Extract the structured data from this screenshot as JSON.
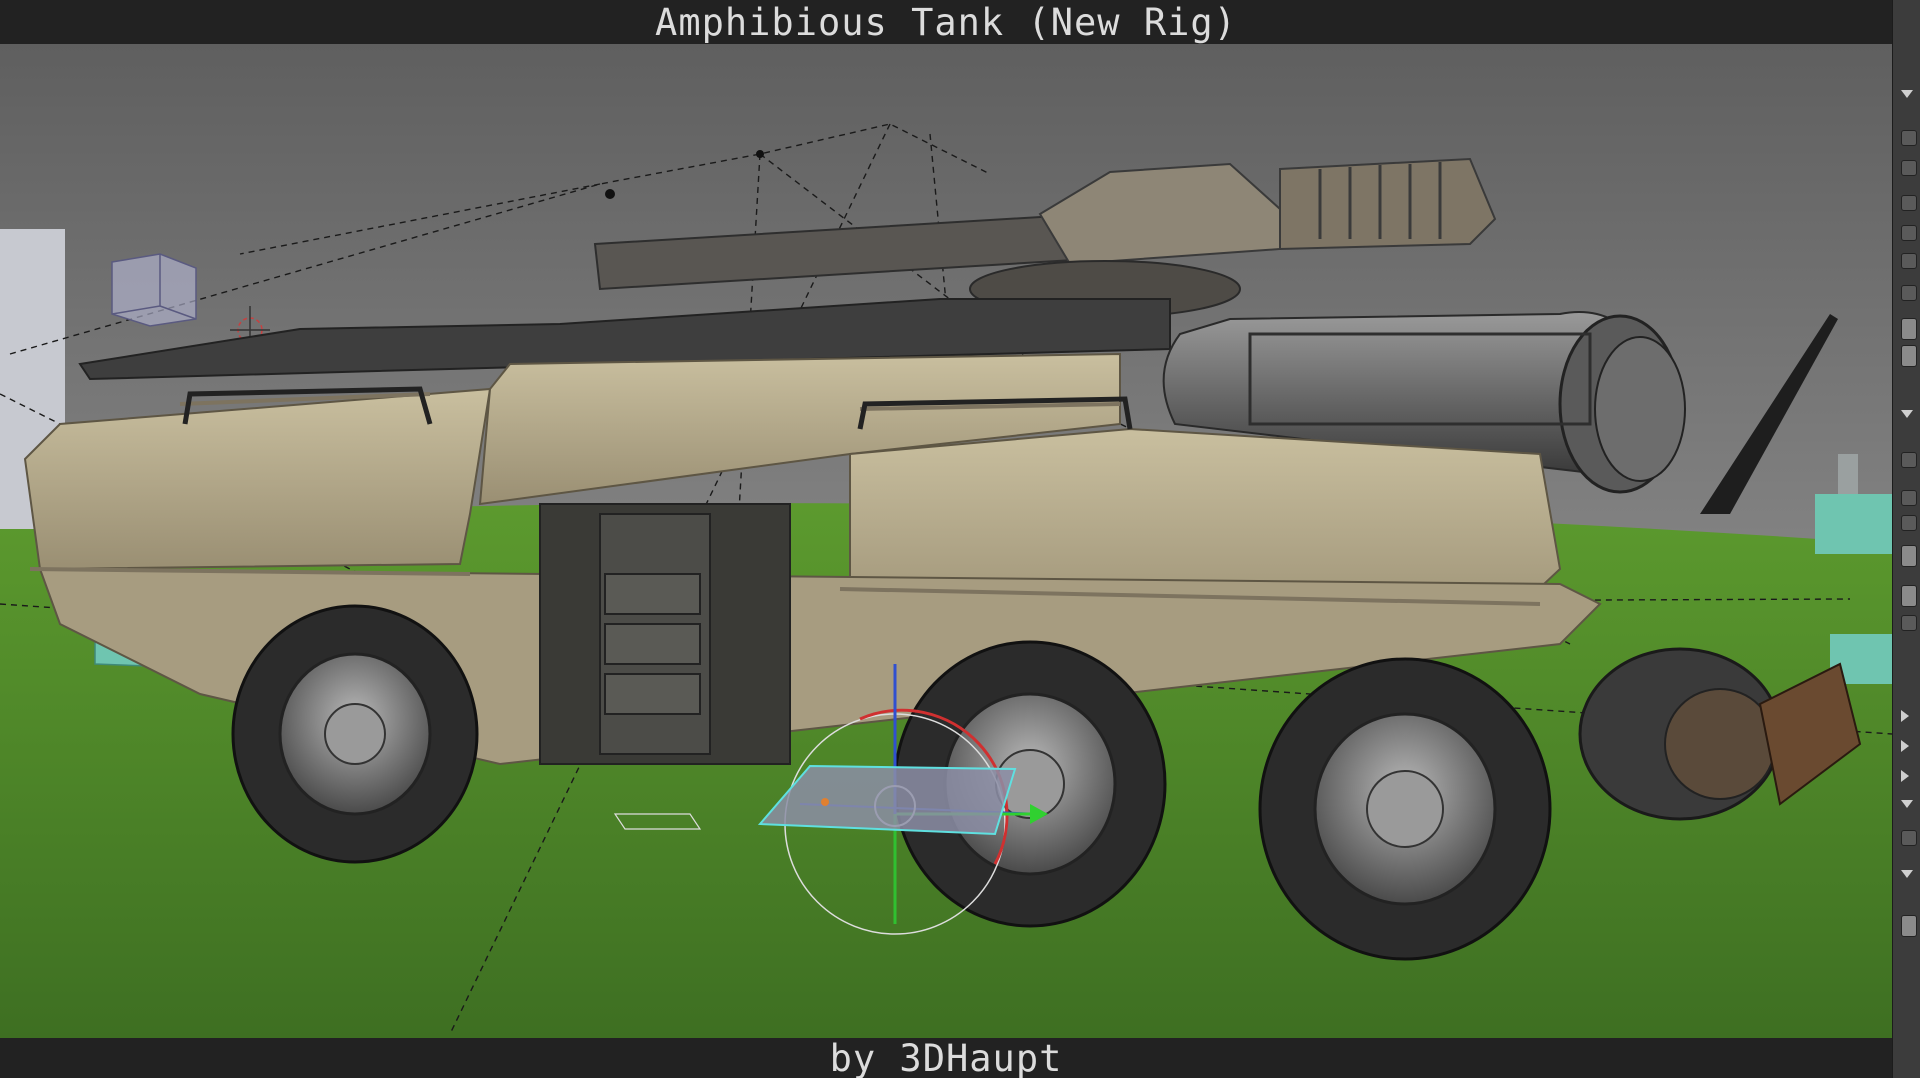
{
  "window": {
    "title": "Amphibious Tank (New Rig)",
    "credit": "by 3DHaupt"
  },
  "viewport": {
    "active_tool": "rotate-manipulator",
    "colors": {
      "sky_top": "#6f6f6f",
      "sky_bottom": "#9a9a9a",
      "ground": "#4f8a2a",
      "hull": "#b3a88c",
      "hull_dark": "#7d735f",
      "metal": "#5d5d5d",
      "tire": "#2a2a2a",
      "control_box": "#6fc5b0"
    }
  },
  "sidebar": {
    "items": [
      {
        "kind": "arrow-down"
      },
      {
        "kind": "check"
      },
      {
        "kind": "check"
      },
      {
        "kind": "check"
      },
      {
        "kind": "check"
      },
      {
        "kind": "check"
      },
      {
        "kind": "check"
      },
      {
        "kind": "button"
      },
      {
        "kind": "button"
      },
      {
        "kind": "arrow-down"
      },
      {
        "kind": "check"
      },
      {
        "kind": "check"
      },
      {
        "kind": "check"
      },
      {
        "kind": "button"
      },
      {
        "kind": "button"
      },
      {
        "kind": "check"
      },
      {
        "kind": "arrow-right"
      },
      {
        "kind": "arrow-right"
      },
      {
        "kind": "arrow-right"
      },
      {
        "kind": "arrow-down"
      },
      {
        "kind": "check"
      },
      {
        "kind": "arrow-down"
      },
      {
        "kind": "button"
      }
    ]
  }
}
